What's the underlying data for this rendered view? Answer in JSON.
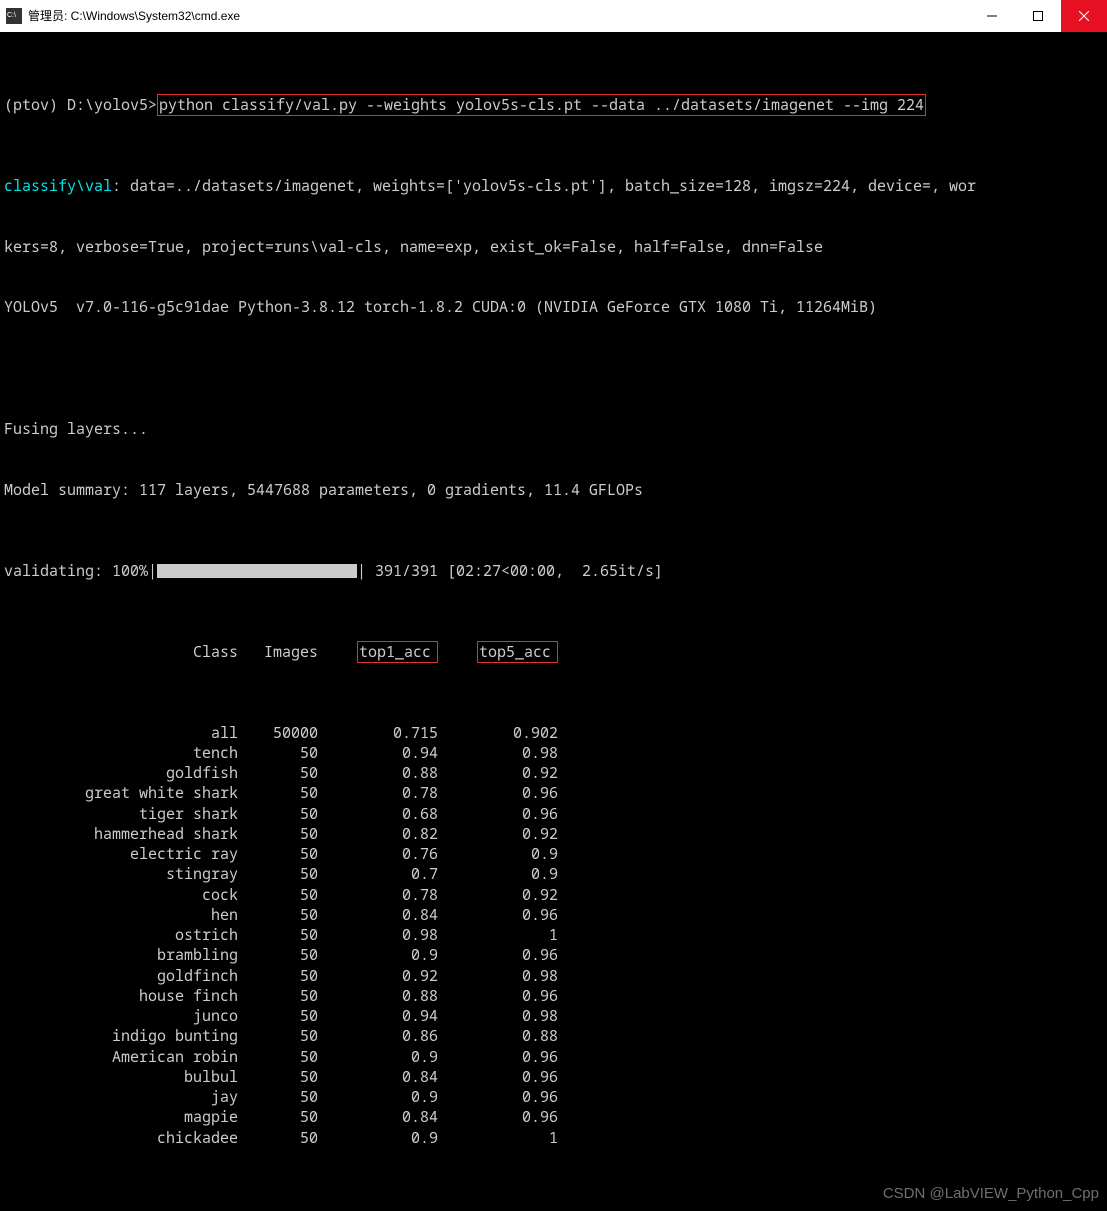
{
  "window_title": "管理员: C:\\Windows\\System32\\cmd.exe",
  "prompt": "(ptov) D:\\yolov5>",
  "command": "python classify/val.py --weights yolov5s-cls.pt --data ../datasets/imagenet --img 224",
  "log1_prefix": "classify\\val",
  "log1_a": ": data=../datasets/imagenet, weights=['yolov5s-cls.pt'], batch_size=128, imgsz=224, device=, wor",
  "log1_b": "kers=8, verbose=True, project=runs\\val-cls, name=exp, exist_ok=False, half=False, dnn=False",
  "log_yolo_a": "YOLOv5  v7.0-116-g5c91dae Python-3.8.12 torch-1.8.2 CUDA:0 (NVIDIA GeForce GTX 1080 Ti, 11264MiB)",
  "fusing": "Fusing layers...",
  "model_summary": "Model summary: 117 layers, 5447688 parameters, 0 gradients, 11.4 GFLOPs",
  "validating": "validating: 100%|",
  "progress_tail": "| 391/391 [02:27<00:00,  2.65it/s]",
  "headers": {
    "class": "Class",
    "images": "Images",
    "top1": "top1_acc",
    "top5": "top5_acc"
  },
  "rows": [
    {
      "class": "all",
      "images": "50000",
      "top1": "0.715",
      "top5": "0.902"
    },
    {
      "class": "tench",
      "images": "50",
      "top1": "0.94",
      "top5": "0.98"
    },
    {
      "class": "goldfish",
      "images": "50",
      "top1": "0.88",
      "top5": "0.92"
    },
    {
      "class": "great white shark",
      "images": "50",
      "top1": "0.78",
      "top5": "0.96"
    },
    {
      "class": "tiger shark",
      "images": "50",
      "top1": "0.68",
      "top5": "0.96"
    },
    {
      "class": "hammerhead shark",
      "images": "50",
      "top1": "0.82",
      "top5": "0.92"
    },
    {
      "class": "electric ray",
      "images": "50",
      "top1": "0.76",
      "top5": "0.9"
    },
    {
      "class": "stingray",
      "images": "50",
      "top1": "0.7",
      "top5": "0.9"
    },
    {
      "class": "cock",
      "images": "50",
      "top1": "0.78",
      "top5": "0.92"
    },
    {
      "class": "hen",
      "images": "50",
      "top1": "0.84",
      "top5": "0.96"
    },
    {
      "class": "ostrich",
      "images": "50",
      "top1": "0.98",
      "top5": "1"
    },
    {
      "class": "brambling",
      "images": "50",
      "top1": "0.9",
      "top5": "0.96"
    },
    {
      "class": "goldfinch",
      "images": "50",
      "top1": "0.92",
      "top5": "0.98"
    },
    {
      "class": "house finch",
      "images": "50",
      "top1": "0.88",
      "top5": "0.96"
    },
    {
      "class": "junco",
      "images": "50",
      "top1": "0.94",
      "top5": "0.98"
    },
    {
      "class": "indigo bunting",
      "images": "50",
      "top1": "0.86",
      "top5": "0.88"
    },
    {
      "class": "American robin",
      "images": "50",
      "top1": "0.9",
      "top5": "0.96"
    },
    {
      "class": "bulbul",
      "images": "50",
      "top1": "0.84",
      "top5": "0.96"
    },
    {
      "class": "jay",
      "images": "50",
      "top1": "0.9",
      "top5": "0.96"
    },
    {
      "class": "magpie",
      "images": "50",
      "top1": "0.84",
      "top5": "0.96"
    },
    {
      "class": "chickadee",
      "images": "50",
      "top1": "0.9",
      "top5": "1"
    }
  ],
  "watermark": "CSDN @LabVIEW_Python_Cpp"
}
